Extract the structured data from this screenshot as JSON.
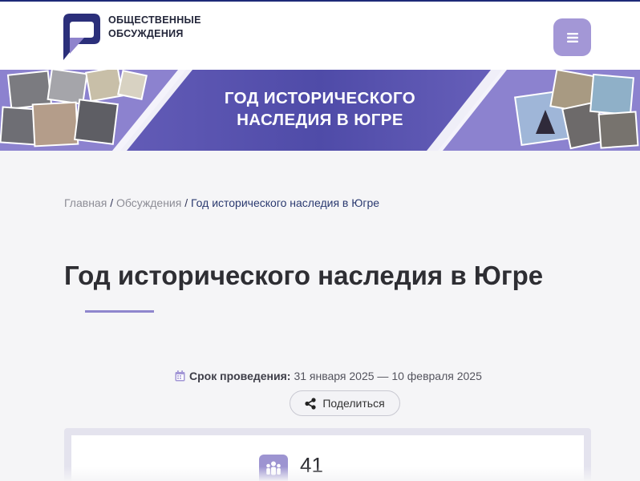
{
  "header": {
    "logo_line1": "ОБЩЕСТВЕННЫЕ",
    "logo_line2": "ОБСУЖДЕНИЯ",
    "menu_icon": "hamburger-icon"
  },
  "banner": {
    "line1": "ГОД ИСТОРИЧЕСКОГО",
    "line2": "НАСЛЕДИЯ В ЮГРЕ"
  },
  "breadcrumb": {
    "home": "Главная",
    "discussions": "Обсуждения",
    "current": "Год исторического наследия в Югре",
    "separator": "/"
  },
  "page": {
    "title": "Год исторического наследия в Югре"
  },
  "period": {
    "label": "Срок проведения:",
    "dates": "31 января 2025 — 10 февраля 2025"
  },
  "share": {
    "label": "Поделиться"
  },
  "stats": {
    "participants": "41"
  },
  "colors": {
    "accent": "#a397d6",
    "brand_dark": "#2b2f7a",
    "banner_bg": "#5a55b0"
  }
}
